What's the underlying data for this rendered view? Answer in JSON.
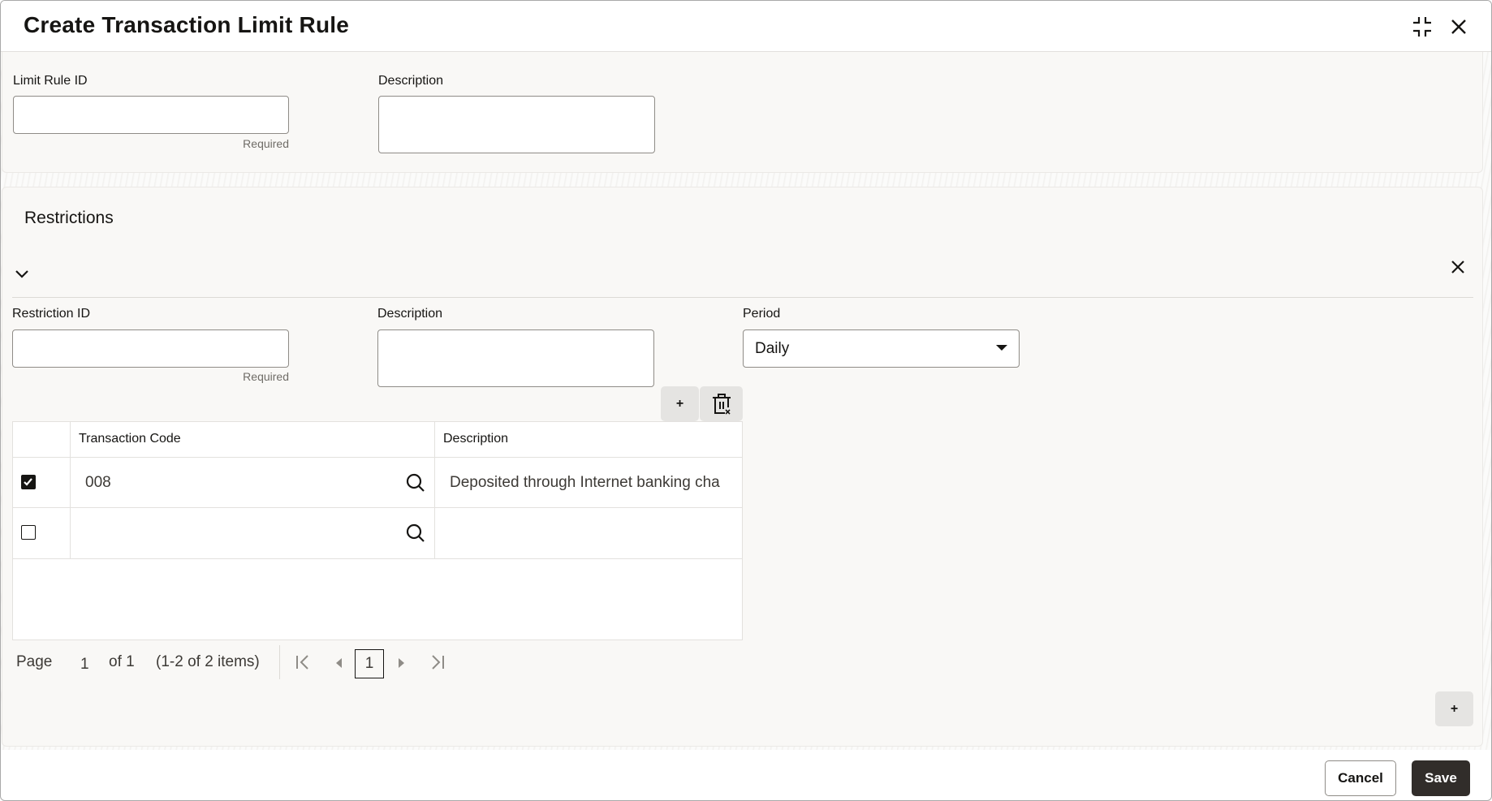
{
  "dialog": {
    "title": "Create Transaction Limit Rule",
    "icons": {
      "minimize": "compress-icon",
      "close": "close-icon"
    }
  },
  "rule": {
    "id_label": "Limit Rule ID",
    "id_value": "",
    "id_hint": "Required",
    "description_label": "Description",
    "description_value": ""
  },
  "restrictions": {
    "section_title": "Restrictions",
    "restriction_id_label": "Restriction ID",
    "restriction_id_value": "",
    "restriction_id_hint": "Required",
    "description_label": "Description",
    "description_value": "",
    "period_label": "Period",
    "period_value": "Daily",
    "add_row_label": "+",
    "table": {
      "columns": [
        "",
        "Transaction Code",
        "Description"
      ],
      "rows": [
        {
          "checked": true,
          "code": "008",
          "description": "Deposited through Internet banking cha"
        },
        {
          "checked": false,
          "code": "",
          "description": ""
        }
      ]
    },
    "pager": {
      "page_label": "Page",
      "page_value": "1",
      "of_label": "of 1",
      "items_label": "(1-2 of 2 items)",
      "current_page": "1"
    },
    "add_restriction_label": "+"
  },
  "footer": {
    "cancel_label": "Cancel",
    "save_label": "Save"
  }
}
